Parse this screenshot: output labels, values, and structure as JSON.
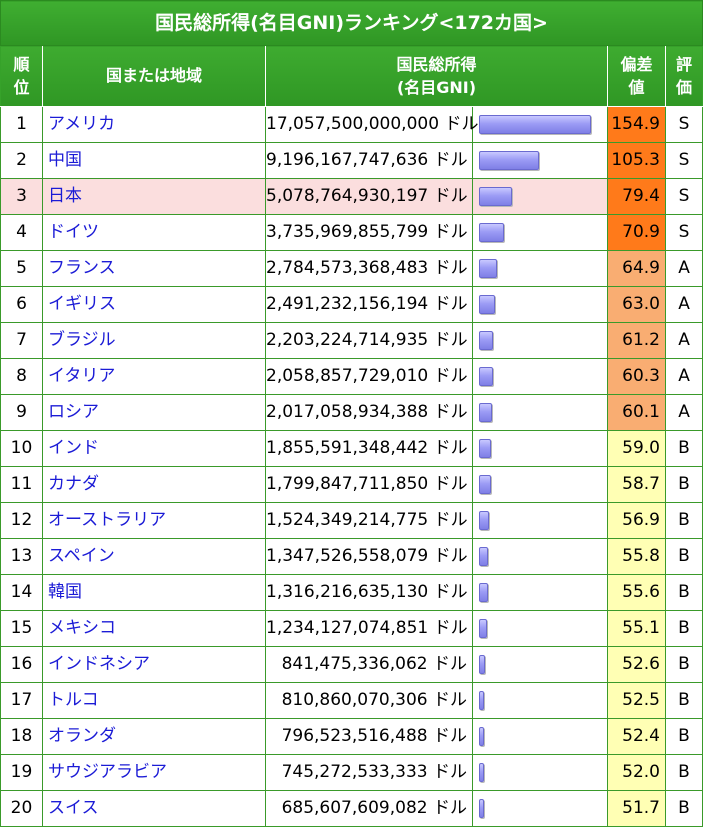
{
  "title": "国民総所得(名目GNI)ランキング<172カ国>",
  "headers": {
    "rank_l1": "順",
    "rank_l2": "位",
    "country": "国または地域",
    "gni_l1": "国民総所得",
    "gni_l2": "(名目GNI)",
    "dev_l1": "偏差",
    "dev_l2": "値",
    "eval_l1": "評",
    "eval_l2": "価"
  },
  "unit": "ドル",
  "colors": {
    "header_green": "#36a22a",
    "link_blue": "#1b1bd6",
    "highlight_row": "#fbdede",
    "grade_s": "#ff7a1a",
    "grade_a": "#f9ad72",
    "grade_b": "#ffffb4"
  },
  "rows": [
    {
      "rank": "1",
      "country": "アメリカ",
      "gni": "17,057,500,000,000",
      "gni_value": 17057500000000,
      "deviation": "154.9",
      "grade": "S"
    },
    {
      "rank": "2",
      "country": "中国",
      "gni": "9,196,167,747,636",
      "gni_value": 9196167747636,
      "deviation": "105.3",
      "grade": "S"
    },
    {
      "rank": "3",
      "country": "日本",
      "gni": "5,078,764,930,197",
      "gni_value": 5078764930197,
      "deviation": "79.4",
      "grade": "S",
      "highlight": true
    },
    {
      "rank": "4",
      "country": "ドイツ",
      "gni": "3,735,969,855,799",
      "gni_value": 3735969855799,
      "deviation": "70.9",
      "grade": "S"
    },
    {
      "rank": "5",
      "country": "フランス",
      "gni": "2,784,573,368,483",
      "gni_value": 2784573368483,
      "deviation": "64.9",
      "grade": "A"
    },
    {
      "rank": "6",
      "country": "イギリス",
      "gni": "2,491,232,156,194",
      "gni_value": 2491232156194,
      "deviation": "63.0",
      "grade": "A"
    },
    {
      "rank": "7",
      "country": "ブラジル",
      "gni": "2,203,224,714,935",
      "gni_value": 2203224714935,
      "deviation": "61.2",
      "grade": "A"
    },
    {
      "rank": "8",
      "country": "イタリア",
      "gni": "2,058,857,729,010",
      "gni_value": 2058857729010,
      "deviation": "60.3",
      "grade": "A"
    },
    {
      "rank": "9",
      "country": "ロシア",
      "gni": "2,017,058,934,388",
      "gni_value": 2017058934388,
      "deviation": "60.1",
      "grade": "A"
    },
    {
      "rank": "10",
      "country": "インド",
      "gni": "1,855,591,348,442",
      "gni_value": 1855591348442,
      "deviation": "59.0",
      "grade": "B"
    },
    {
      "rank": "11",
      "country": "カナダ",
      "gni": "1,799,847,711,850",
      "gni_value": 1799847711850,
      "deviation": "58.7",
      "grade": "B"
    },
    {
      "rank": "12",
      "country": "オーストラリア",
      "gni": "1,524,349,214,775",
      "gni_value": 1524349214775,
      "deviation": "56.9",
      "grade": "B"
    },
    {
      "rank": "13",
      "country": "スペイン",
      "gni": "1,347,526,558,079",
      "gni_value": 1347526558079,
      "deviation": "55.8",
      "grade": "B"
    },
    {
      "rank": "14",
      "country": "韓国",
      "gni": "1,316,216,635,130",
      "gni_value": 1316216635130,
      "deviation": "55.6",
      "grade": "B"
    },
    {
      "rank": "15",
      "country": "メキシコ",
      "gni": "1,234,127,074,851",
      "gni_value": 1234127074851,
      "deviation": "55.1",
      "grade": "B"
    },
    {
      "rank": "16",
      "country": "インドネシア",
      "gni": "841,475,336,062",
      "gni_value": 841475336062,
      "deviation": "52.6",
      "grade": "B"
    },
    {
      "rank": "17",
      "country": "トルコ",
      "gni": "810,860,070,306",
      "gni_value": 810860070306,
      "deviation": "52.5",
      "grade": "B"
    },
    {
      "rank": "18",
      "country": "オランダ",
      "gni": "796,523,516,488",
      "gni_value": 796523516488,
      "deviation": "52.4",
      "grade": "B"
    },
    {
      "rank": "19",
      "country": "サウジアラビア",
      "gni": "745,272,533,333",
      "gni_value": 745272533333,
      "deviation": "52.0",
      "grade": "B"
    },
    {
      "rank": "20",
      "country": "スイス",
      "gni": "685,607,609,082",
      "gni_value": 685607609082,
      "deviation": "51.7",
      "grade": "B"
    }
  ]
}
